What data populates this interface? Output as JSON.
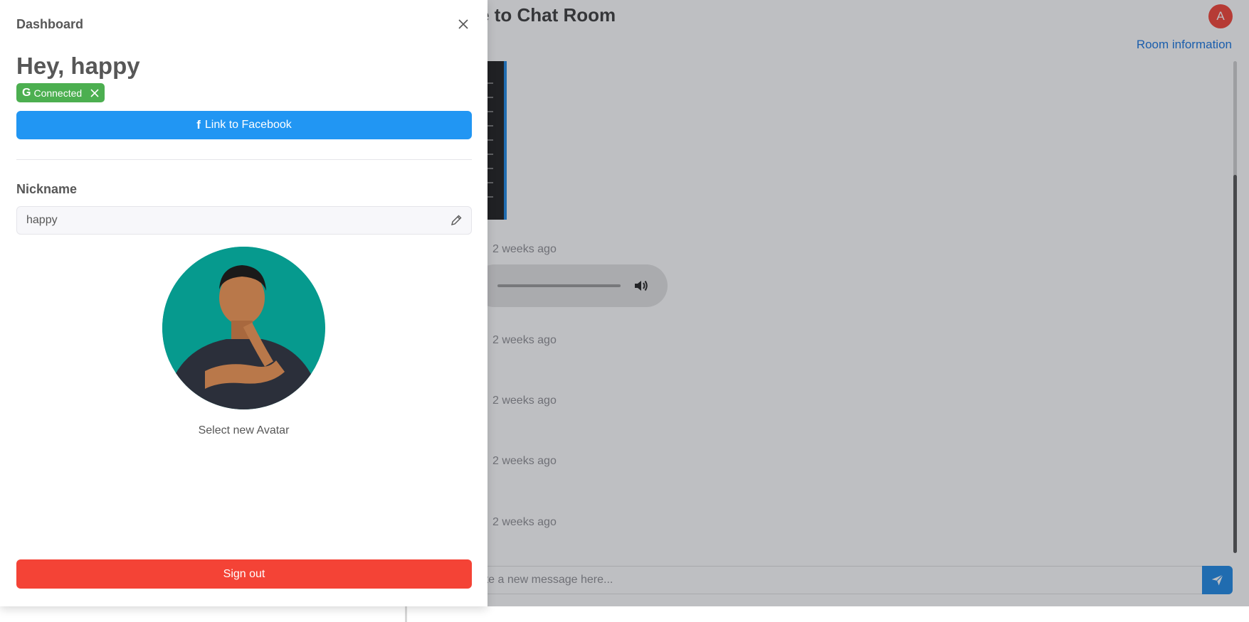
{
  "chat": {
    "room_title": "e to Chat Room",
    "room_info_link": "Room information",
    "user_initial": "A",
    "timestamps": [
      "2 weeks ago",
      "2 weeks ago",
      "2 weeks ago",
      "2 weeks ago",
      "2 weeks ago"
    ],
    "composer_placeholder": "Write a new message here..."
  },
  "drawer": {
    "title": "Dashboard",
    "greeting": "Hey, happy",
    "badge": {
      "provider_letter": "G",
      "label": "Connected"
    },
    "facebook_button": "Link to Facebook",
    "nickname_label": "Nickname",
    "nickname_value": "happy",
    "select_avatar_label": "Select new Avatar",
    "sign_out_button": "Sign out"
  },
  "colors": {
    "connected_badge": "#4caf50",
    "facebook_button": "#2196f3",
    "sign_out_button": "#f44336",
    "avatar_background": "#069a8e",
    "accent_blue": "#1e88e5"
  }
}
